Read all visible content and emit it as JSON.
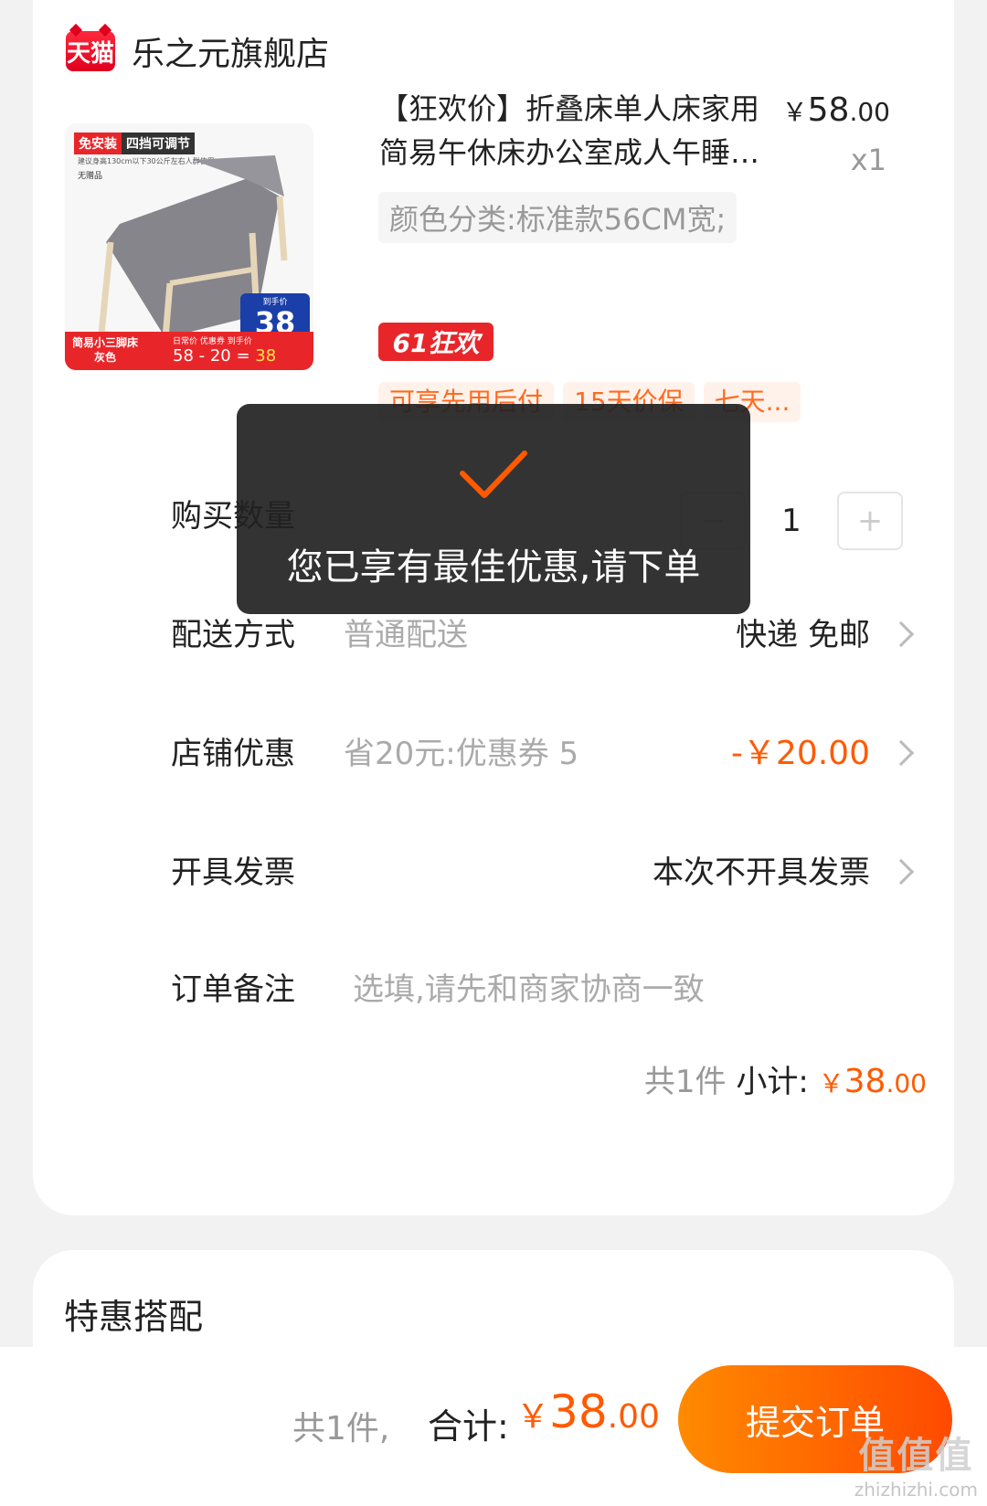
{
  "store": {
    "logo_text": "天猫",
    "name": "乐之元旗舰店"
  },
  "product": {
    "image": {
      "tag_install": "免安装",
      "tag_adjust": "四挡可调节",
      "note": "建议身高130cm以下30公斤左右人群使用",
      "gift": "无赠品",
      "badge_label": "到手价",
      "badge_price": "38",
      "bar_name": "简易小三脚床",
      "bar_color": "灰色",
      "bar_calc_labels": "日常价  优惠券  到手价",
      "bar_calc": "58 - 20 = ",
      "bar_calc_result": "38"
    },
    "title_line1": "【狂欢价】折叠床单人床家用",
    "title_line2": "简易午休床办公室成人午睡…",
    "price_currency": "￥",
    "price_int": "58",
    "price_dec": ".00",
    "quantity_label": "x1",
    "sku": "颜色分类:标准款56CM宽;",
    "promo_badge": "61狂欢",
    "service_tags": [
      "可享先用后付",
      "15天价保",
      "七天..."
    ]
  },
  "rows": {
    "quantity": {
      "label": "购买数量",
      "minus": "−",
      "value": "1",
      "plus": "+"
    },
    "delivery": {
      "label": "配送方式",
      "sub": "普通配送",
      "value": "快递 免邮"
    },
    "discount": {
      "label": "店铺优惠",
      "sub": "省20元:优惠券 5",
      "value": "-￥20.00"
    },
    "invoice": {
      "label": "开具发票",
      "value": "本次不开具发票"
    },
    "note": {
      "label": "订单备注",
      "placeholder": "选填,请先和商家协商一致"
    }
  },
  "subtotal": {
    "count": "共1件",
    "label": "小计:",
    "currency": "￥",
    "int": "38",
    "dec": ".00"
  },
  "bundle": {
    "title": "特惠搭配"
  },
  "bottom": {
    "count": "共1件,",
    "total_label": "合计:",
    "currency": "￥",
    "int": "38",
    "dec": ".00",
    "submit_label": "提交订单"
  },
  "toast": {
    "text": "您已享有最佳优惠,请下单"
  },
  "watermark": {
    "logo": "值值值",
    "url": "zhizhizhi.com"
  },
  "colors": {
    "accent": "#ff5a00",
    "tmall_red": "#e8262a"
  }
}
